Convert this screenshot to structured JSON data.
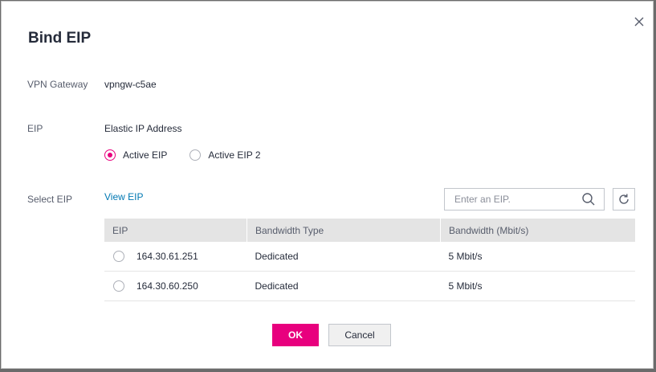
{
  "dialog": {
    "title": "Bind EIP",
    "close_icon": "close-icon"
  },
  "fields": {
    "vpn_gateway_label": "VPN Gateway",
    "vpn_gateway_value": "vpngw-c5ae",
    "eip_label": "EIP",
    "eip_value": "Elastic IP Address",
    "select_eip_label": "Select EIP"
  },
  "eip_options": [
    {
      "label": "Active EIP",
      "selected": true
    },
    {
      "label": "Active EIP 2",
      "selected": false
    }
  ],
  "view_eip_link": "View EIP",
  "search": {
    "placeholder": "Enter an EIP.",
    "value": ""
  },
  "table": {
    "headers": [
      "EIP",
      "Bandwidth Type",
      "Bandwidth (Mbit/s)"
    ],
    "rows": [
      {
        "eip": "164.30.61.251",
        "type": "Dedicated",
        "bandwidth": "5 Mbit/s"
      },
      {
        "eip": "164.30.60.250",
        "type": "Dedicated",
        "bandwidth": "5 Mbit/s"
      }
    ]
  },
  "buttons": {
    "ok": "OK",
    "cancel": "Cancel"
  },
  "colors": {
    "accent": "#e8007e",
    "link": "#0078b3",
    "header_bg": "#e4e4e4"
  }
}
